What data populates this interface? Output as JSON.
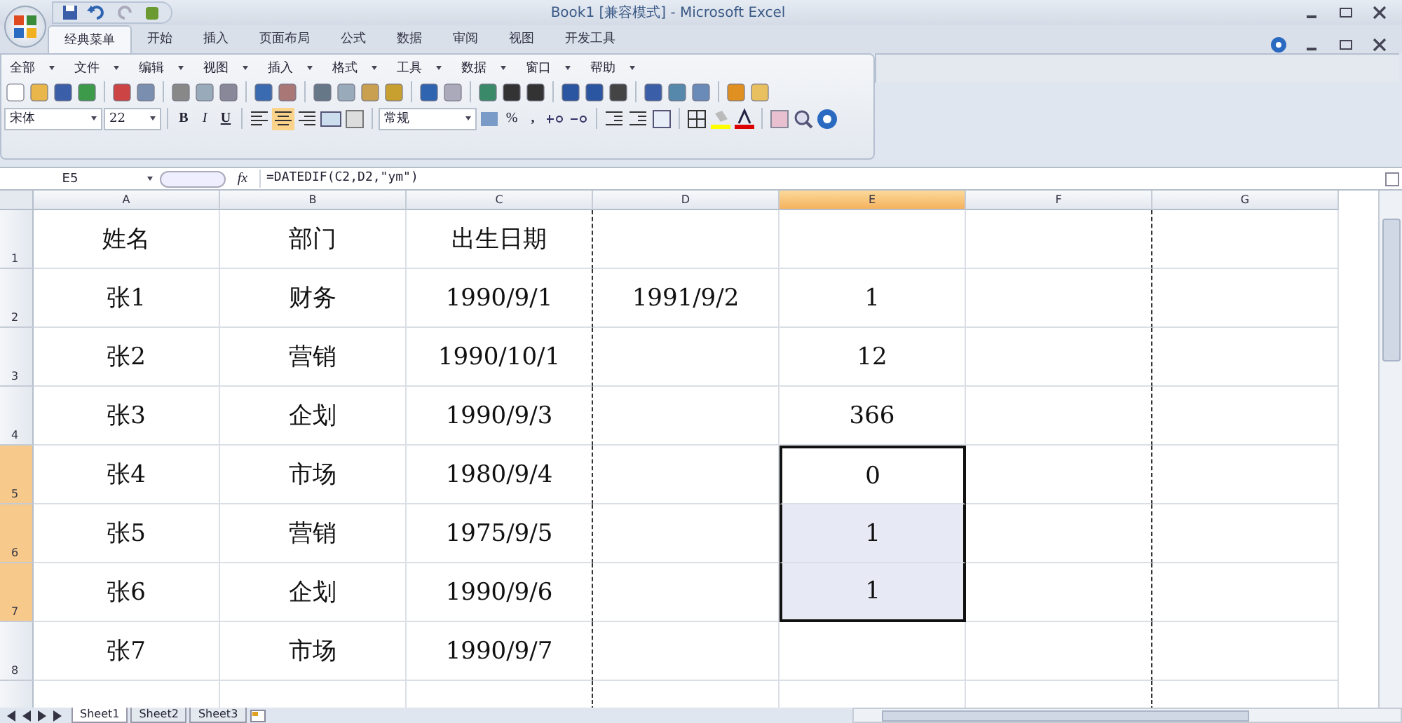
{
  "window": {
    "title": "Book1  [兼容模式] - Microsoft Excel"
  },
  "ribbon_tabs": [
    {
      "label": "经典菜单",
      "selected": true
    },
    {
      "label": "开始",
      "selected": false
    },
    {
      "label": "插入",
      "selected": false
    },
    {
      "label": "页面布局",
      "selected": false
    },
    {
      "label": "公式",
      "selected": false
    },
    {
      "label": "数据",
      "selected": false
    },
    {
      "label": "审阅",
      "selected": false
    },
    {
      "label": "视图",
      "selected": false
    },
    {
      "label": "开发工具",
      "selected": false
    }
  ],
  "menus": [
    "全部",
    "文件",
    "编辑",
    "视图",
    "插入",
    "格式",
    "工具",
    "数据",
    "窗口",
    "帮助"
  ],
  "format_bar": {
    "font": "宋体",
    "size": "22",
    "bold": "B",
    "italic": "I",
    "underline": "U",
    "number_format": "常规",
    "percent": "%",
    "comma": ","
  },
  "formula_bar": {
    "name_box": "E5",
    "fx": "fx",
    "formula": "=DATEDIF(C2,D2,\"ym\")"
  },
  "columns": [
    {
      "label": "A",
      "selected": false
    },
    {
      "label": "B",
      "selected": false
    },
    {
      "label": "C",
      "selected": false
    },
    {
      "label": "D",
      "selected": false
    },
    {
      "label": "E",
      "selected": true
    },
    {
      "label": "F",
      "selected": false
    },
    {
      "label": "G",
      "selected": false
    }
  ],
  "rows": [
    {
      "label": "1",
      "selected": false,
      "cells": [
        "姓名",
        "部门",
        "出生日期",
        "",
        "",
        "",
        ""
      ]
    },
    {
      "label": "2",
      "selected": false,
      "cells": [
        "张1",
        "财务",
        "1990/9/1",
        "1991/9/2",
        "1",
        "",
        ""
      ]
    },
    {
      "label": "3",
      "selected": false,
      "cells": [
        "张2",
        "营销",
        "1990/10/1",
        "",
        "12",
        "",
        ""
      ]
    },
    {
      "label": "4",
      "selected": false,
      "cells": [
        "张3",
        "企划",
        "1990/9/3",
        "",
        "366",
        "",
        ""
      ]
    },
    {
      "label": "5",
      "selected": true,
      "cells": [
        "张4",
        "市场",
        "1980/9/4",
        "",
        "0",
        "",
        ""
      ]
    },
    {
      "label": "6",
      "selected": true,
      "cells": [
        "张5",
        "营销",
        "1975/9/5",
        "",
        "1",
        "",
        ""
      ]
    },
    {
      "label": "7",
      "selected": true,
      "cells": [
        "张6",
        "企划",
        "1990/9/6",
        "",
        "1",
        "",
        ""
      ]
    },
    {
      "label": "8",
      "selected": false,
      "cells": [
        "张7",
        "市场",
        "1990/9/7",
        "",
        "",
        "",
        ""
      ]
    }
  ],
  "sheet_tabs": [
    {
      "label": "Sheet1",
      "selected": true
    },
    {
      "label": "Sheet2",
      "selected": false
    },
    {
      "label": "Sheet3",
      "selected": false
    }
  ]
}
